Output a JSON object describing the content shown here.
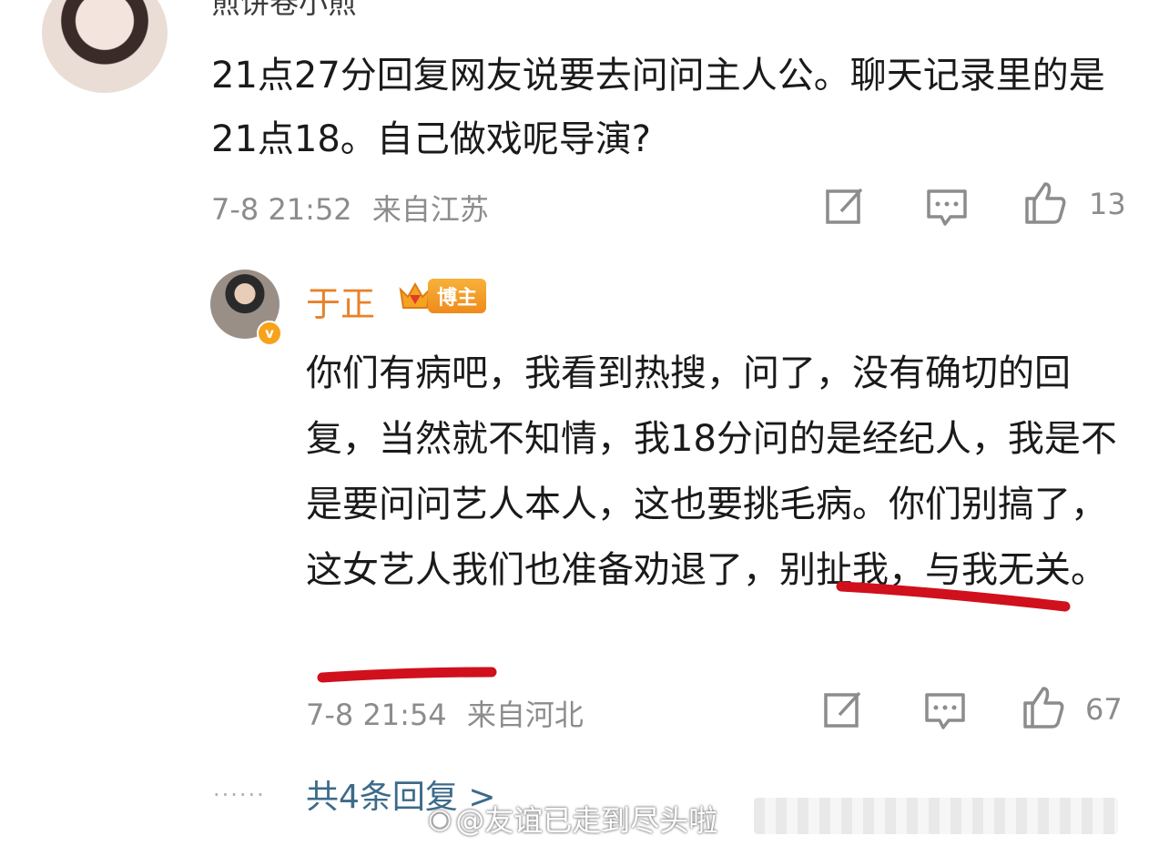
{
  "top_comment": {
    "username": "煎饼卷小煎",
    "text": "21点27分回复网友说要去问问主人公。聊天记录里的是21点18。自己做戏呢导演?",
    "time": "7-8 21:52",
    "location": "来自江苏",
    "like_count": "13"
  },
  "reply": {
    "username": "于正",
    "badge": "博主",
    "text": "你们有病吧，我看到热搜，问了，没有确切的回复，当然就不知情，我18分问的是经纪人，我是不是要问问艺人本人，这也要挑毛病。你们别搞了，这女艺人我们也准备劝退了，别扯我，与我无关。",
    "time": "7-8 21:54",
    "location": "来自河北",
    "like_count": "67"
  },
  "more_replies": {
    "dots": "......",
    "label": "共4条回复 >"
  },
  "watermark": {
    "text": "@友谊已走到尽头啦"
  },
  "icons": {
    "share": "share-icon",
    "comment": "comment-icon",
    "like": "thumbs-up-icon",
    "verified": "verified-v-icon",
    "crown": "crown-icon"
  },
  "colors": {
    "username_accent": "#e8812a",
    "link_blue": "#3c6a8a",
    "meta_gray": "#8c8c8c",
    "underline_red": "#d0101c"
  }
}
